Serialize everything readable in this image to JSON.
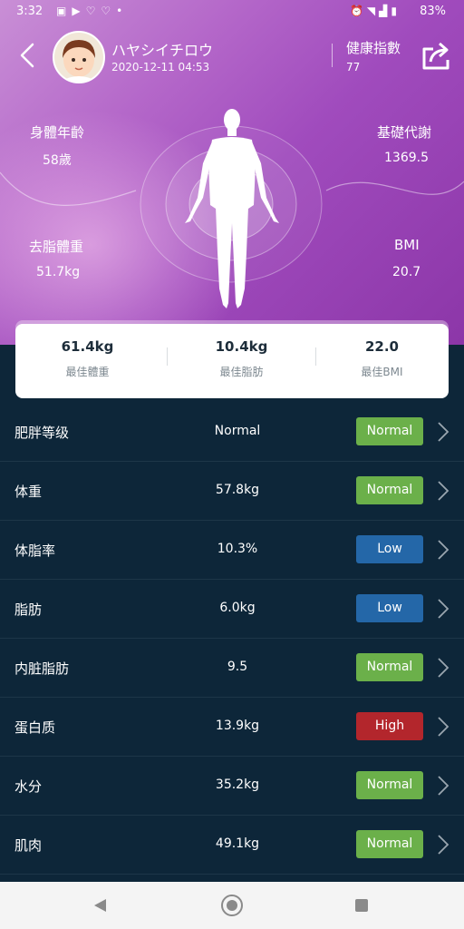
{
  "status_bar": {
    "time": "3:32",
    "battery": "83%",
    "left_icons": [
      "image-icon",
      "youtube-icon",
      "heart-icon",
      "heart-icon",
      "dot-icon"
    ],
    "right_icons": [
      "alarm-icon",
      "wifi-icon",
      "signal-icon",
      "battery-icon"
    ]
  },
  "header": {
    "user_name": "ハヤシイチロウ",
    "datetime": "2020-12-11 04:53",
    "health_index_label": "健康指數",
    "health_index_value": "77"
  },
  "metrics": {
    "body_age": {
      "label": "身體年齡",
      "value": "58歲"
    },
    "bmr": {
      "label": "基礎代謝",
      "value": "1369.5"
    },
    "lean_mass": {
      "label": "去脂體重",
      "value": "51.7kg"
    },
    "bmi": {
      "label": "BMI",
      "value": "20.7"
    }
  },
  "summary_card": [
    {
      "value": "61.4kg",
      "label": "最佳體重"
    },
    {
      "value": "10.4kg",
      "label": "最佳脂肪"
    },
    {
      "value": "22.0",
      "label": "最佳BMI"
    }
  ],
  "status_colors": {
    "Normal": "#6bb04a",
    "Low": "#2467a8",
    "High": "#b3262c"
  },
  "rows": [
    {
      "name": "肥胖等级",
      "value": "Normal",
      "status": "Normal"
    },
    {
      "name": "体重",
      "value": "57.8kg",
      "status": "Normal"
    },
    {
      "name": "体脂率",
      "value": "10.3%",
      "status": "Low"
    },
    {
      "name": "脂肪",
      "value": "6.0kg",
      "status": "Low"
    },
    {
      "name": "内脏脂肪",
      "value": "9.5",
      "status": "Normal"
    },
    {
      "name": "蛋白质",
      "value": "13.9kg",
      "status": "High"
    },
    {
      "name": "水分",
      "value": "35.2kg",
      "status": "Normal"
    },
    {
      "name": "肌肉",
      "value": "49.1kg",
      "status": "Normal"
    }
  ]
}
